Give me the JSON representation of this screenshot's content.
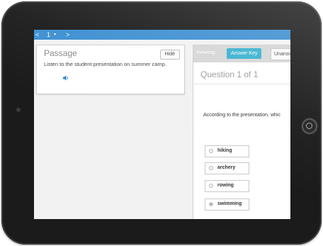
{
  "device": {
    "frame_color": "#1b1b1b",
    "camera_icon": "camera-dot",
    "home_button_icon": "home-button"
  },
  "toolbar": {
    "prev_icon": "<",
    "question_number": "1",
    "dropdown_icon": "▾",
    "next_icon": ">",
    "accent": "#3d8fd1"
  },
  "passage": {
    "title": "Passage",
    "hide_label": "Hide",
    "text": "Listen to the student presentation on summer camp.",
    "audio_icon": "speaker-icon"
  },
  "question": {
    "viewing_label": "Viewing:",
    "answer_key_label": "Answer Key",
    "unanswered_label": "Unansw",
    "title": "Question 1 of 1",
    "prompt": "According to the presentation, whic",
    "options": [
      {
        "label": "hiking",
        "selected": false
      },
      {
        "label": "archery",
        "selected": false
      },
      {
        "label": "rowing",
        "selected": false
      },
      {
        "label": "swimming",
        "selected": true
      }
    ],
    "answer_key_color": "#39b1cf"
  }
}
